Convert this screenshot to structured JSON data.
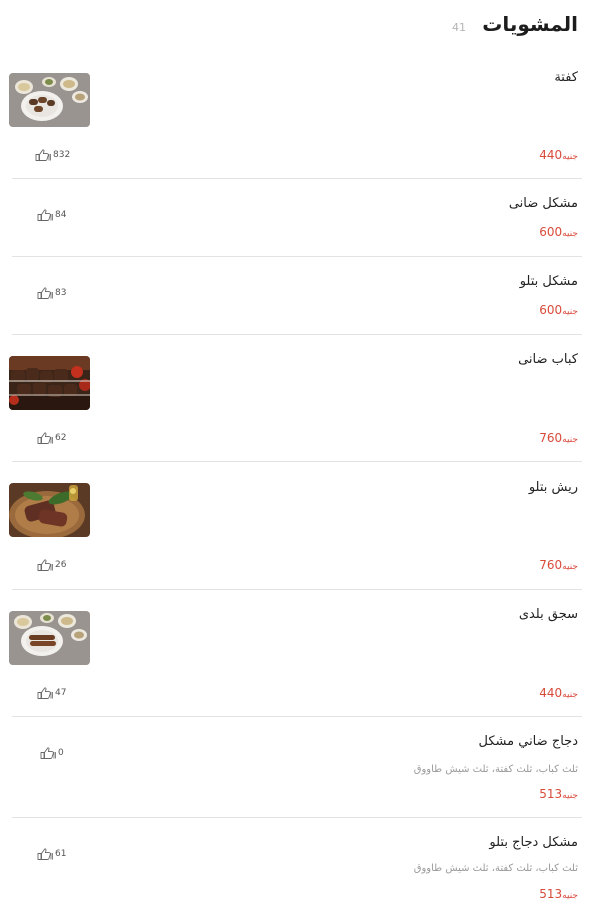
{
  "header": {
    "title": "المشويات",
    "count": "41"
  },
  "currency": "جنيه",
  "items": [
    {
      "name": "كفتة",
      "price": "440",
      "likes": "832"
    },
    {
      "name": "مشكل ضانى",
      "price": "600",
      "likes": "84"
    },
    {
      "name": "مشكل بتلو",
      "price": "600",
      "likes": "83"
    },
    {
      "name": "كباب ضانى",
      "price": "760",
      "likes": "62"
    },
    {
      "name": "ريش بتلو",
      "price": "760",
      "likes": "26"
    },
    {
      "name": "سجق بلدى",
      "price": "440",
      "likes": "47"
    },
    {
      "name": "دجاج ضاني مشكل",
      "desc": "ثلث كباب، ثلث كفتة، ثلث شيش طاووق",
      "price": "513",
      "likes": "0"
    },
    {
      "name": "مشكل دجاج بتلو",
      "desc": "ثلث كباب، ثلث كفتة، ثلث شيش طاووق",
      "price": "513",
      "likes": "61"
    }
  ]
}
